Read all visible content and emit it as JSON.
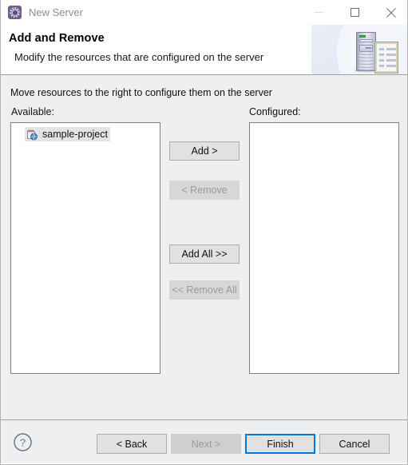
{
  "window": {
    "title": "New Server",
    "title_icon": "server-gear-icon",
    "controls": {
      "minimize": "minimize-icon",
      "maximize": "maximize-icon",
      "close": "close-icon"
    }
  },
  "header": {
    "title": "Add and Remove",
    "description": "Modify the resources that are configured on the server",
    "banner_icons": [
      "server-tower-icon",
      "document-icon"
    ]
  },
  "body": {
    "instruction": "Move resources to the right to configure them on the server",
    "available": {
      "label": "Available:",
      "items": [
        {
          "name": "sample-project",
          "icon": "project-icon",
          "selected": true
        }
      ]
    },
    "configured": {
      "label": "Configured:",
      "items": []
    },
    "transfer_buttons": [
      {
        "label": "Add >",
        "enabled": true
      },
      {
        "label": "< Remove",
        "enabled": false
      },
      {
        "label": "Add All >>",
        "enabled": true
      },
      {
        "label": "<< Remove All",
        "enabled": false
      }
    ]
  },
  "footer": {
    "help_icon": "help-question-icon",
    "buttons": [
      {
        "label": "< Back",
        "state": "enabled"
      },
      {
        "label": "Next >",
        "state": "disabled"
      },
      {
        "label": "Finish",
        "state": "default"
      },
      {
        "label": "Cancel",
        "state": "enabled"
      }
    ]
  },
  "colors": {
    "accent_focus": "#0078d7",
    "dialog_bg": "#efefef",
    "header_bg": "#ffffff",
    "button_bg": "#e1e1e1",
    "border": "#a0a0a0",
    "selection": "#e4e4e4",
    "title_text": "#8c8c8c",
    "disabled_text": "#9a9a9a",
    "led_green": "#3ec23e",
    "titlebar_icon": "#6f5b8e"
  }
}
